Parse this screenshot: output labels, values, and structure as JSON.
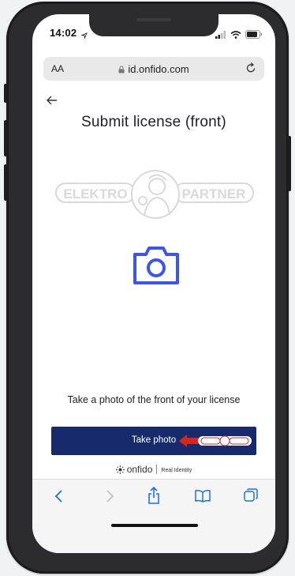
{
  "status_bar": {
    "time": "14:02"
  },
  "browser": {
    "text_size_label": "AA",
    "url": "id.onfido.com"
  },
  "page": {
    "title": "Submit license (front)",
    "instruction": "Take a photo of the front of your license",
    "take_photo_label": "Take photo"
  },
  "watermark": {
    "text_left": "ELEKTRO",
    "text_right": "PARTNER"
  },
  "footer": {
    "brand": "onfido",
    "tagline": "Real Identity"
  },
  "icons": [
    "back-arrow-icon",
    "lock-icon",
    "reload-icon",
    "camera-icon",
    "onfido-logo-icon",
    "chevron-left-icon",
    "chevron-right-icon",
    "share-icon",
    "bookmarks-icon",
    "tabs-icon",
    "signal-icon",
    "wifi-icon",
    "battery-icon"
  ],
  "colors": {
    "primary_button": "#172a6b",
    "camera_icon": "#3a55f0",
    "safari_toolbar_icon": "#1a73e8",
    "promo_red": "#d9251c"
  }
}
